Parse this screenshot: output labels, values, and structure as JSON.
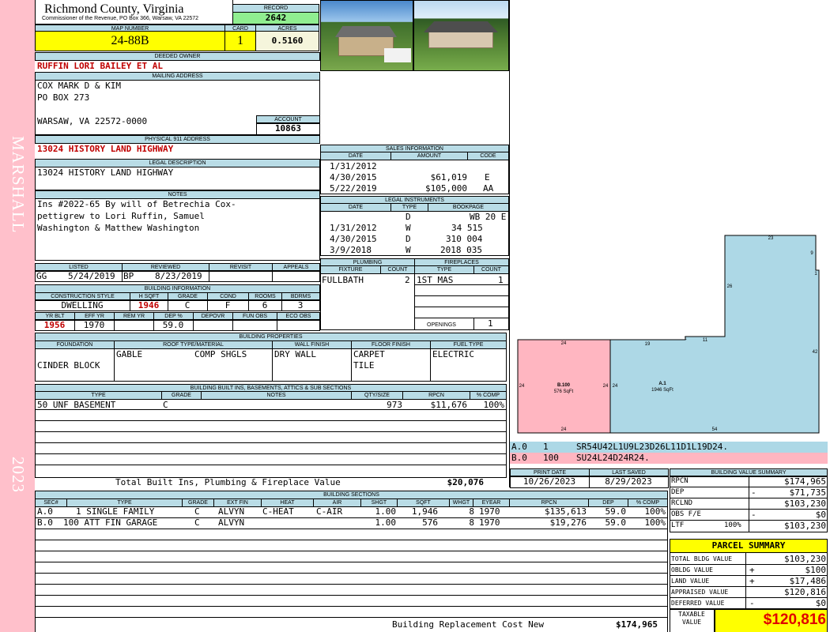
{
  "side": {
    "owner": "MARSHALL",
    "year": "2023"
  },
  "county": {
    "name": "Richmond County, Virginia",
    "office": "Commissioner of the Revenue, PO Box 366, Warsaw, VA 22572"
  },
  "record": {
    "label": "RECORD",
    "value": "2642"
  },
  "map": {
    "label": "MAP NUMBER",
    "value": "24-88B",
    "card_label": "CARD",
    "card": "1",
    "acres_label": "ACRES",
    "acres": "0.5160"
  },
  "owner": {
    "label": "DEEDED OWNER",
    "value": "RUFFIN LORI BAILEY ET AL"
  },
  "mailing": {
    "label": "MAILING ADDRESS",
    "line1": "COX MARK D & KIM",
    "line2": "PO BOX 273",
    "line3": "WARSAW, VA 22572-0000"
  },
  "account": {
    "label": "ACCOUNT",
    "value": "10863"
  },
  "physical": {
    "label": "PHYSICAL 911 ADDRESS",
    "value": "13024 HISTORY LAND HIGHWAY"
  },
  "legal": {
    "label": "LEGAL DESCRIPTION",
    "value": "13024 HISTORY LAND HIGHWAY"
  },
  "notes": {
    "label": "NOTES",
    "line1": "Ins #2022-65 By will of Betrechia Cox-",
    "line2": "pettigrew to Lori Ruffin, Samuel",
    "line3": "Washington & Matthew Washington"
  },
  "listing": {
    "listed_label": "LISTED",
    "reviewed_label": "REVIEWED",
    "revisit_label": "REVISIT",
    "appeals_label": "APPEALS",
    "listed_by": "GG",
    "listed_date": "5/24/2019",
    "reviewed_by": "BP",
    "reviewed_date": "8/23/2019"
  },
  "bldg_info": {
    "label": "BUILDING INFORMATION",
    "h_style": "CONSTRUCTION STYLE",
    "h_hsqft": "H SQFT",
    "h_grade": "GRADE",
    "h_cond": "COND",
    "h_rooms": "ROOMS",
    "h_bdrms": "BDRMS",
    "style": "DWELLING",
    "hsqft": "1946",
    "grade": "C",
    "cond": "F",
    "rooms": "6",
    "bdrms": "3",
    "h_yrblt": "YR BLT",
    "h_effyr": "EFF YR",
    "h_remyr": "REM YR",
    "h_dep": "DEP %",
    "h_depovr": "DEPOVR",
    "h_funobs": "FUN OBS",
    "h_ecoobs": "ECO OBS",
    "yrblt": "1956",
    "effyr": "1970",
    "dep": "59.0"
  },
  "sales": {
    "label": "SALES INFORMATION",
    "h_date": "DATE",
    "h_amount": "AMOUNT",
    "h_code": "CODE",
    "rows": [
      {
        "date": "1/31/2012",
        "amount": "",
        "code": ""
      },
      {
        "date": "4/30/2015",
        "amount": "$61,019",
        "code": "E"
      },
      {
        "date": "5/22/2019",
        "amount": "$105,000",
        "code": "AA"
      }
    ]
  },
  "legal_inst": {
    "label": "LEGAL INSTRUMENTS",
    "h_date": "DATE",
    "h_type": "TYPE",
    "h_bookpage": "BOOKPAGE",
    "rows": [
      {
        "date": "",
        "type": "D",
        "bookpage": "WB 20 E"
      },
      {
        "date": "1/31/2012",
        "type": "W",
        "bookpage": "34 515"
      },
      {
        "date": "4/30/2015",
        "type": "D",
        "bookpage": "310 004"
      },
      {
        "date": "3/9/2018",
        "type": "W",
        "bookpage": "2018 035"
      }
    ]
  },
  "plumbing": {
    "label": "PLUMBING",
    "h_fixture": "FIXTURE",
    "h_count": "COUNT",
    "fixture": "FULLBATH",
    "count": "2"
  },
  "fireplaces": {
    "label": "FIREPLACES",
    "h_type": "TYPE",
    "h_count": "COUNT",
    "type": "1ST MAS",
    "count": "1",
    "openings_label": "OPENINGS",
    "openings": "1"
  },
  "props": {
    "label": "BUILDING PROPERTIES",
    "h_found": "FOUNDATION",
    "h_roof": "ROOF TYPE/MATERIAL",
    "h_wall": "WALL FINISH",
    "h_floor": "FLOOR FINISH",
    "h_fuel": "FUEL TYPE",
    "found": "CINDER BLOCK",
    "roof_type": "GABLE",
    "roof_mat": "COMP SHGLS",
    "wall": "DRY WALL",
    "floor1": "CARPET",
    "floor2": "TILE",
    "fuel": "ELECTRIC"
  },
  "builtins": {
    "label": "BUILDING BUILT INS, BASEMENTS, ATTICS & SUB SECTIONS",
    "h_type": "TYPE",
    "h_grade": "GRADE",
    "h_notes": "NOTES",
    "h_qty": "QTY/SIZE",
    "h_rpcn": "RPCN",
    "h_comp": "% COMP",
    "rows": [
      {
        "type": "50 UNF BASEMENT",
        "grade": "C",
        "notes": "",
        "qty": "973",
        "rpcn": "$11,676",
        "comp": "100%"
      }
    ],
    "total_label": "Total Built Ins, Plumbing & Fireplace Value",
    "total": "$20,076"
  },
  "sections": {
    "label": "BUILDING SECTIONS",
    "h_sec": "SEC#",
    "h_type": "TYPE",
    "h_grade": "GRADE",
    "h_extfin": "EXT FIN",
    "h_heat": "HEAT",
    "h_air": "AIR",
    "h_shgt": "SHGT",
    "h_sqft": "SQFT",
    "h_whgt": "WHGT",
    "h_eyear": "EYEAR",
    "h_rpcn": "RPCN",
    "h_dep": "DEP",
    "h_comp": "% COMP",
    "rows": [
      {
        "sec": "A.0",
        "type": "1 SINGLE FAMILY",
        "grade": "C",
        "extfin": "ALVYN",
        "heat": "C-HEAT",
        "air": "C-AIR",
        "shgt": "1.00",
        "sqft": "1,946",
        "whgt": "8",
        "eyear": "1970",
        "rpcn": "$135,613",
        "dep": "59.0",
        "comp": "100%"
      },
      {
        "sec": "B.0",
        "type": "100 ATT FIN GARAGE",
        "grade": "C",
        "extfin": "ALVYN",
        "heat": "",
        "air": "",
        "shgt": "1.00",
        "sqft": "576",
        "whgt": "8",
        "eyear": "1970",
        "rpcn": "$19,276",
        "dep": "59.0",
        "comp": "100%"
      }
    ],
    "brcn_label": "Building Replacement Cost New",
    "brcn": "$174,965"
  },
  "sketch": {
    "a_label": "A.1",
    "a_sqft": "1946 SqFt",
    "b_label": "B.100",
    "b_sqft": "576 SqFt",
    "dims": {
      "d23": "23",
      "d9": "9",
      "d1": "1",
      "d26": "26",
      "d42": "42",
      "d19": "19",
      "d11": "11",
      "d1b": "1",
      "d24a": "24",
      "d24b": "24",
      "d24c": "24",
      "d24d": "24",
      "d24e": "24",
      "d54": "54"
    },
    "code_a": {
      "sec": "A.0",
      "num": "1",
      "code": "SR54U42L1U9L23D26L11D1L19D24."
    },
    "code_b": {
      "sec": "B.0",
      "num": "100",
      "code": "SU24L24D24R24."
    },
    "colors": {
      "a": "#add8e6",
      "b": "#ffb6c1"
    }
  },
  "print": {
    "print_label": "PRINT DATE",
    "print_date": "10/26/2023",
    "saved_label": "LAST SAVED",
    "saved_date": "8/29/2023"
  },
  "bvs": {
    "label": "BUILDING VALUE SUMMARY",
    "rows": [
      {
        "k": "RPCN",
        "s": "",
        "v": "$174,965"
      },
      {
        "k": "DEP",
        "s": "-",
        "v": "$71,735"
      },
      {
        "k": "RCLND",
        "s": "",
        "v": "$103,230"
      },
      {
        "k": "OBS F/E",
        "s": "-",
        "v": "$0"
      },
      {
        "k": "LTF",
        "p": "100%",
        "s": "",
        "v": "$103,230"
      }
    ]
  },
  "parcel": {
    "label": "PARCEL SUMMARY",
    "rows": [
      {
        "k": "TOTAL BLDG VALUE",
        "s": "",
        "v": "$103,230"
      },
      {
        "k": "OBLDG VALUE",
        "s": "+",
        "v": "$100"
      },
      {
        "k": "LAND VALUE",
        "s": "+",
        "v": "$17,486"
      },
      {
        "k": "APPRAISED VALUE",
        "s": "",
        "v": "$120,816"
      },
      {
        "k": "DEFERRED VALUE",
        "s": "-",
        "v": "$0"
      }
    ],
    "taxable_label1": "TAXABLE",
    "taxable_label2": "VALUE",
    "taxable": "$120,816"
  }
}
